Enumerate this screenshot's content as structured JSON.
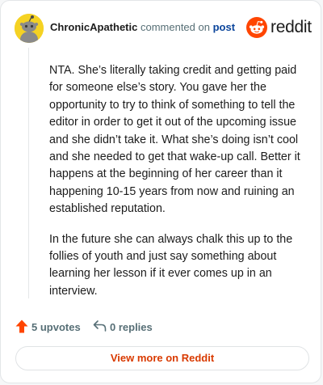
{
  "header": {
    "username": "ChronicApathetic",
    "action_text": "commented on",
    "post_link": "post",
    "brand_name": "reddit"
  },
  "comment": {
    "paragraphs": [
      "NTA. She’s literally taking credit and getting paid for someone else’s story. You gave her the opportunity to try to think of something to tell the editor in order to get it out of the upcoming issue and she didn’t take it. What she’s doing isn’t cool and she needed to get that wake-up call. Better it happens at the beginning of her career than it happening 10-15 years from now and ruining an established reputation.",
      "In the future she can always chalk this up to the follies of youth and just say something about learning her lesson if it ever comes up in an interview."
    ]
  },
  "stats": {
    "upvotes_label": "5 upvotes",
    "replies_label": "0 replies"
  },
  "footer": {
    "view_more_label": "View more on Reddit"
  },
  "colors": {
    "brand": "#ff4500",
    "upvote": "#ff4500",
    "link": "#0a449b",
    "view_more": "#d93a00",
    "avatar_bg": "#f5d223"
  },
  "icons": {
    "avatar": "snoo-avatar-icon",
    "brand": "reddit-logo-icon",
    "upvote": "upvote-arrow-icon",
    "reply": "reply-arrow-icon"
  }
}
